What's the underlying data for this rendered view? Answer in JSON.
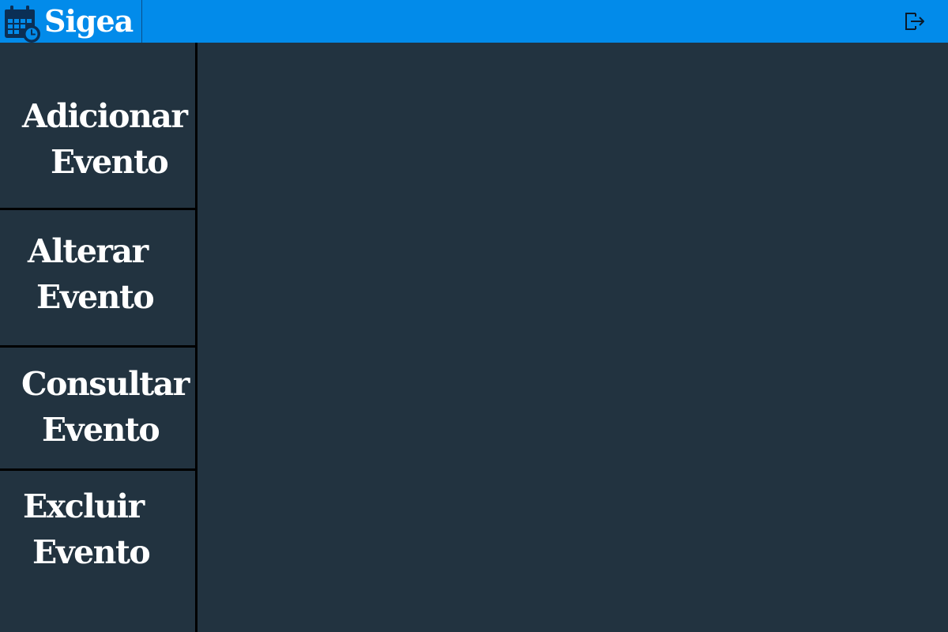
{
  "app": {
    "title": "Sigea",
    "brand_icon": "calendar-clock-icon",
    "logout_icon": "logout-icon"
  },
  "colors": {
    "topbar": "#028bea",
    "background": "#223340",
    "text": "#ffffff",
    "divider": "#000000"
  },
  "sidebar": {
    "items": [
      {
        "line1": "Adicionar",
        "line2": "Evento"
      },
      {
        "line1": "Alterar",
        "line2": "Evento"
      },
      {
        "line1": "Consultar",
        "line2": "Evento"
      },
      {
        "line1": "Excluir",
        "line2": "Evento"
      }
    ]
  }
}
